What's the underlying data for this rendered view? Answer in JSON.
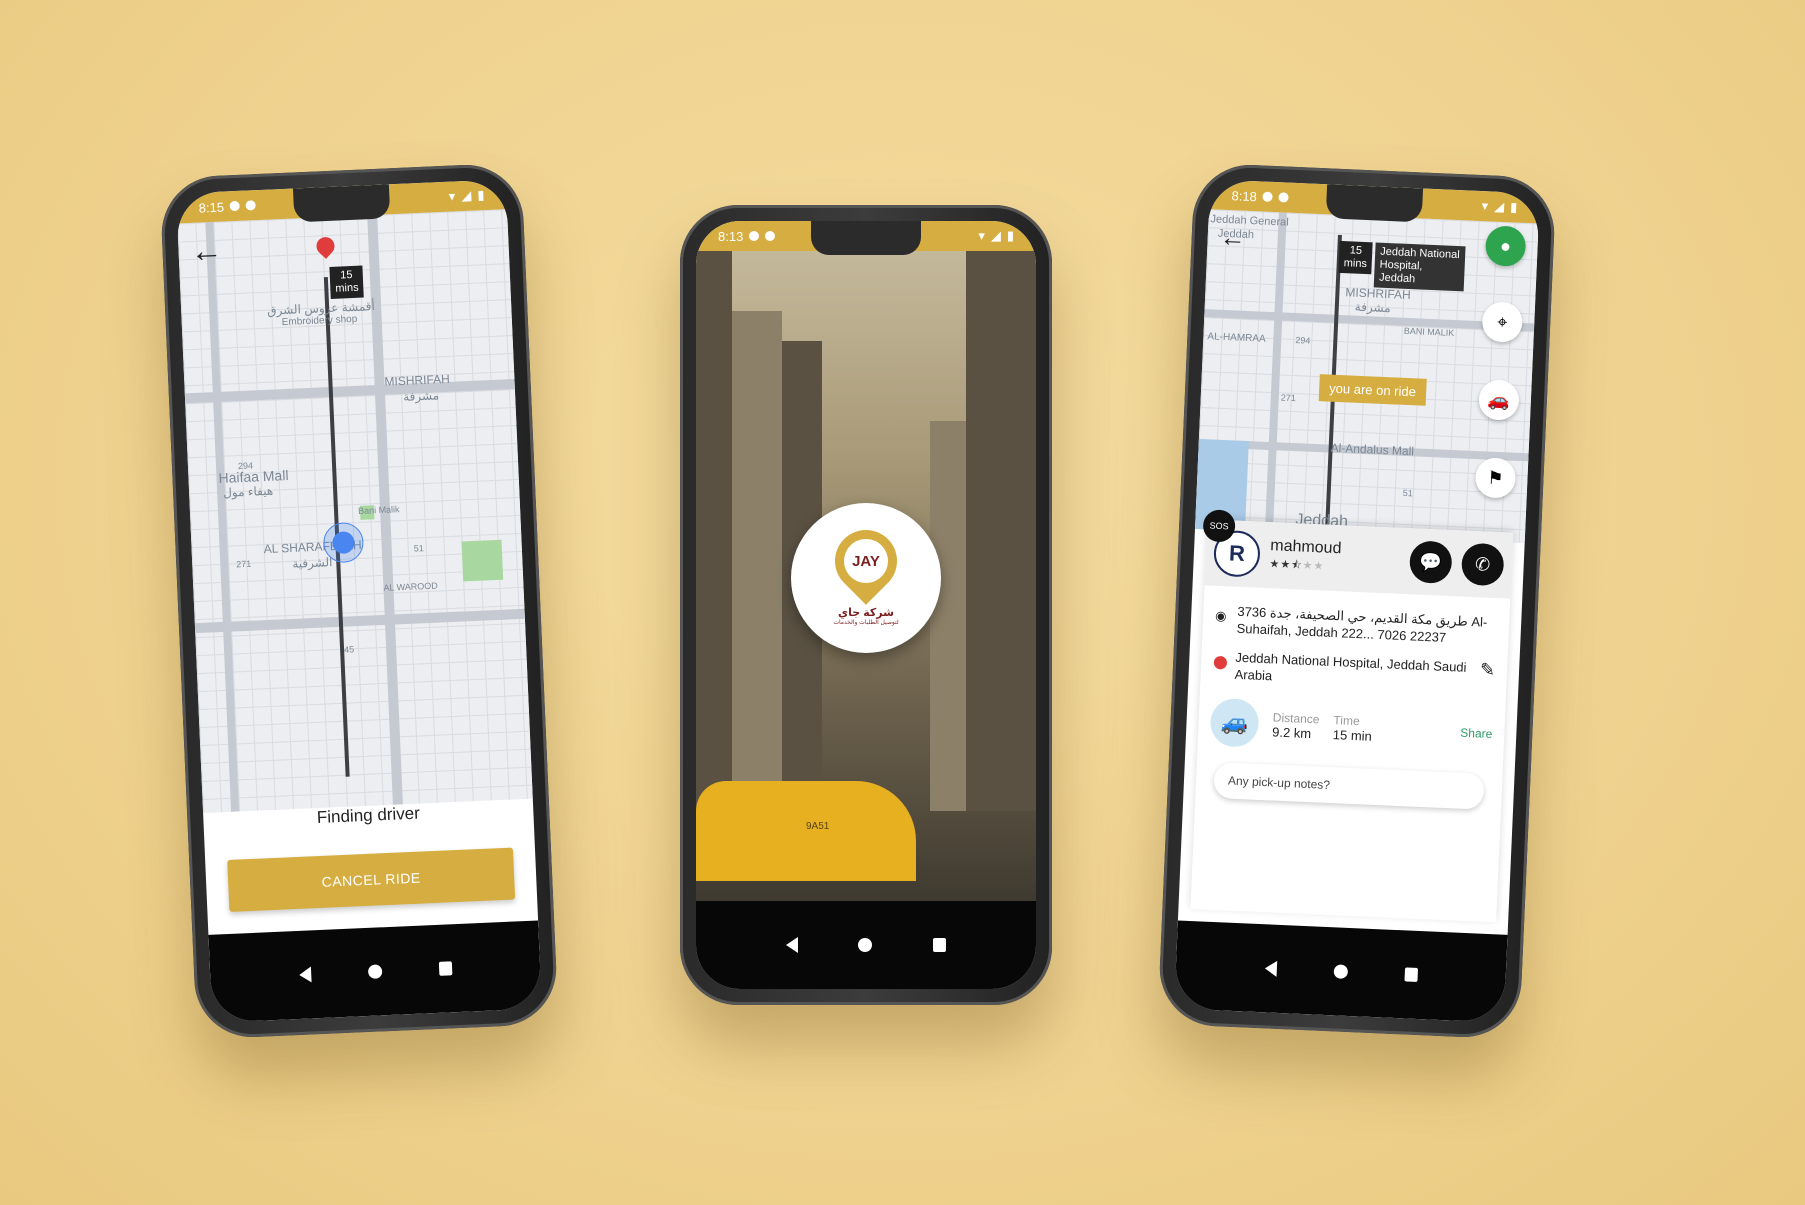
{
  "left_phone": {
    "status_time": "8:15",
    "eta": {
      "line1": "15",
      "line2": "mins"
    },
    "map_labels": [
      "أقمشة عروس الشرق",
      "Embroidery shop",
      "MISHRIFAH",
      "مشرفة",
      "Haifaa Mall",
      "هيفاء مول",
      "Bani Malik",
      "AL SHARAFEYAH",
      "الشرفية",
      "AL WAROOD",
      "271",
      "294",
      "51",
      "45"
    ],
    "finding_text": "Finding driver",
    "cancel_label": "CANCEL RIDE"
  },
  "center_phone": {
    "status_time": "8:13",
    "logo_text": "JAY",
    "logo_arabic": "شركة جاي",
    "logo_arabic_sub": "لتوصيل الطلبات والخدمات",
    "taxi_plate": "9A51"
  },
  "right_phone": {
    "status_time": "8:18",
    "eta": {
      "line1": "15",
      "line2": "mins"
    },
    "destination_tag": "Jeddah National Hospital, Jeddah",
    "map_labels": [
      "Jeddah General",
      "Jeddah",
      "MISHRIFAH",
      "مشرفة",
      "BANI MALIK",
      "AL-HAMRAA",
      "Al-Andalus Mall",
      "Jeddah",
      "294",
      "271",
      "51"
    ],
    "on_ride_tag": "you are on ride",
    "sos": "SOS",
    "driver": {
      "initial": "R",
      "name": "mahmoud",
      "rating": 2.5
    },
    "pickup": "3736 طريق مكة القديم، حي الصحيفة، جدة Al-Suhaifah, Jeddah 222... 7026 22237",
    "dropoff": "Jeddah National Hospital, Jeddah Saudi Arabia",
    "distance_label": "Distance",
    "distance_value": "9.2 km",
    "time_label": "Time",
    "time_value": "15 min",
    "share_label": "Share",
    "notes_placeholder": "Any pick-up notes?"
  },
  "colors": {
    "gold": "#d5ad41",
    "background": "#f0d492"
  }
}
